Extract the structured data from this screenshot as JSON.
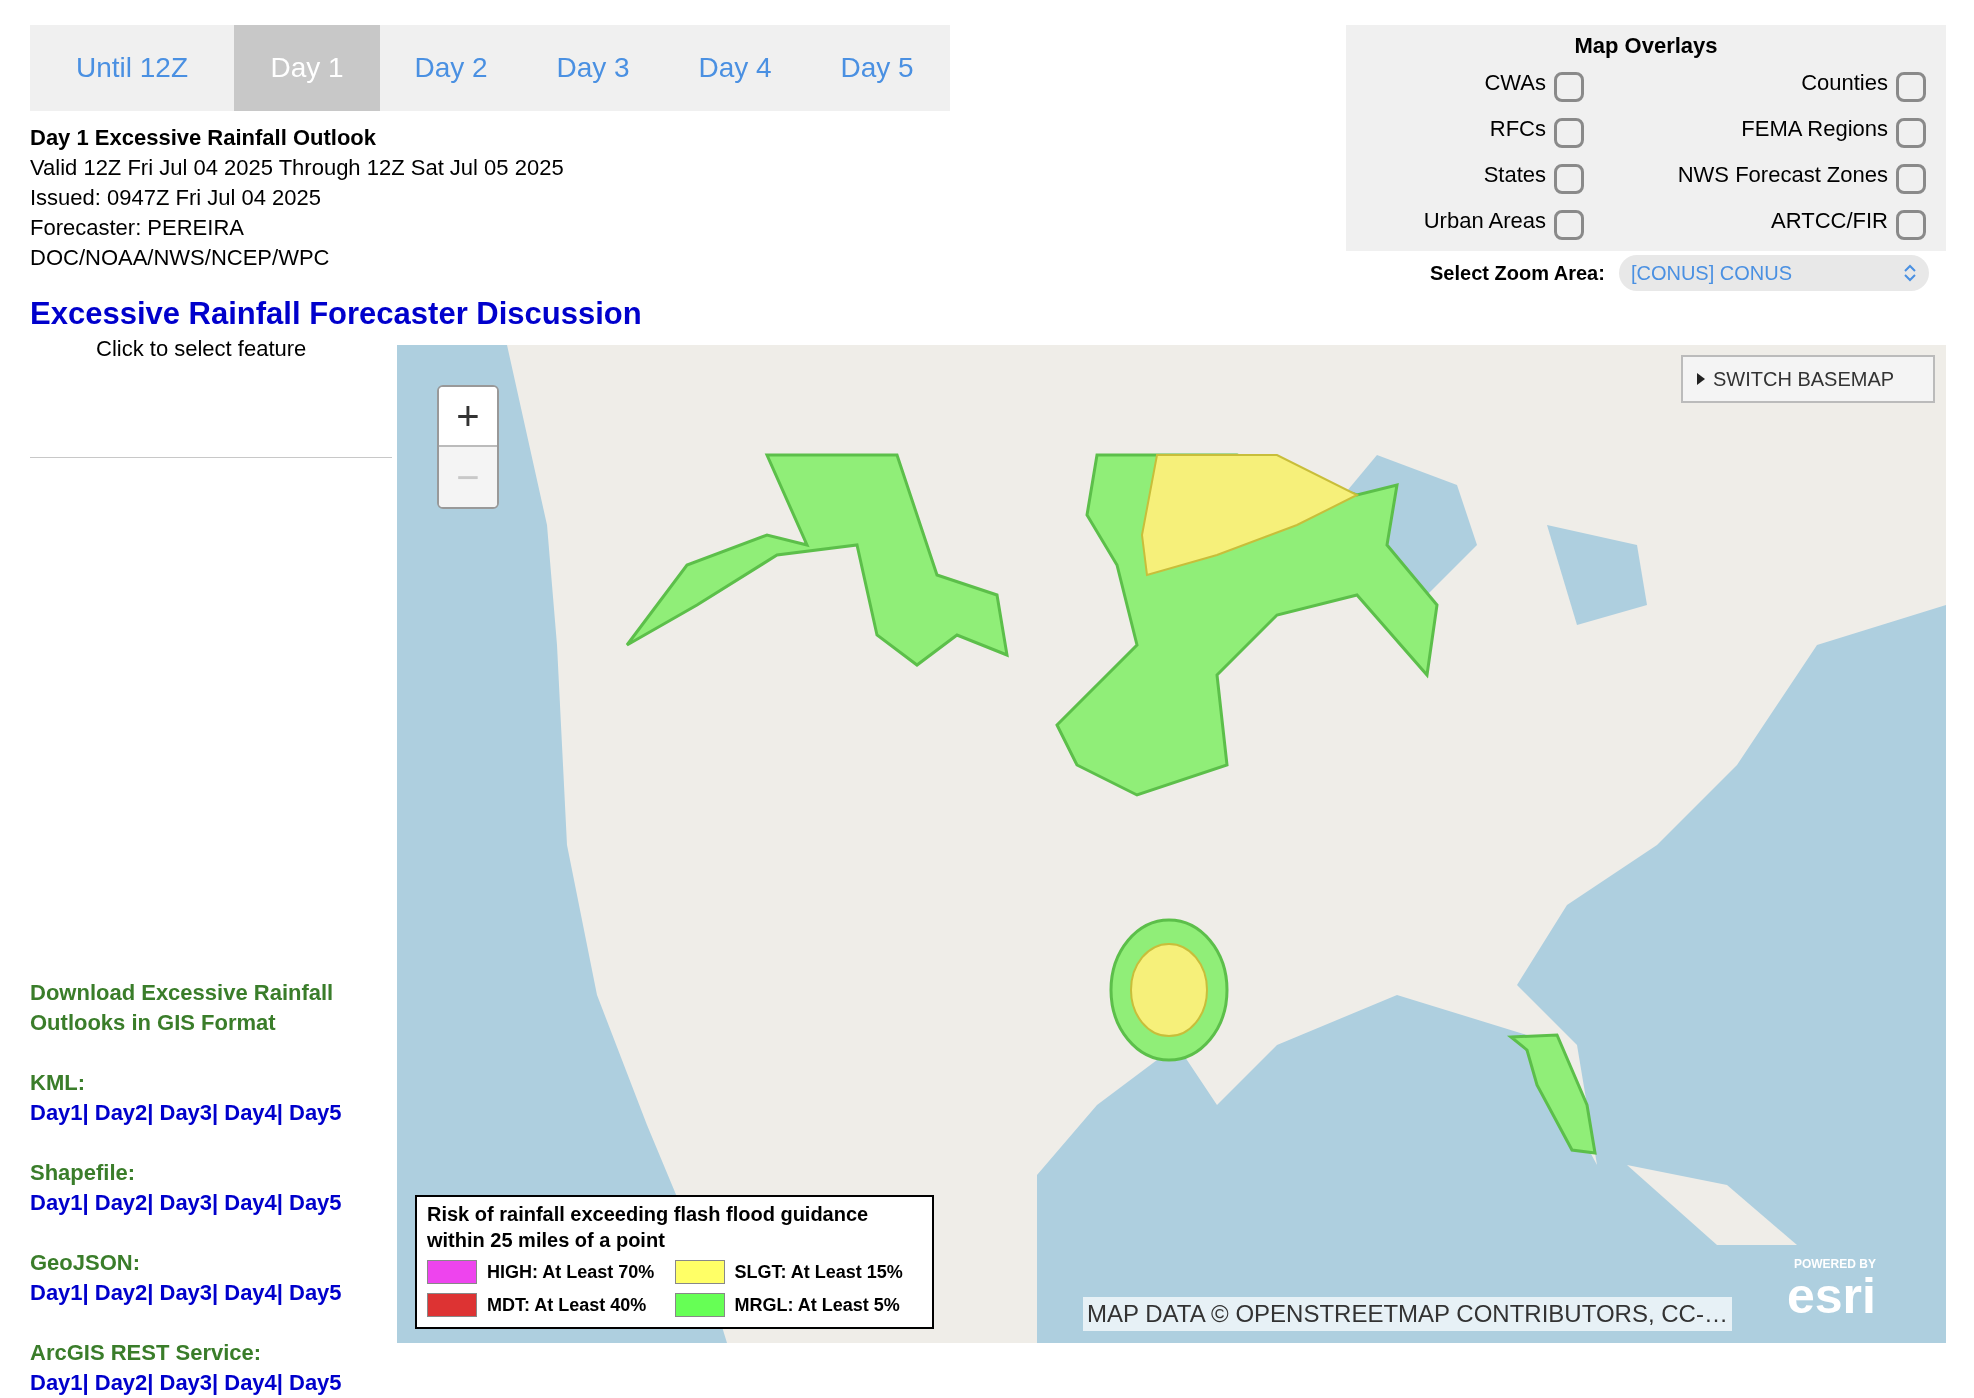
{
  "tabs": [
    {
      "label": "Until 12Z",
      "selected": false
    },
    {
      "label": "Day 1",
      "selected": true
    },
    {
      "label": "Day 2",
      "selected": false
    },
    {
      "label": "Day 3",
      "selected": false
    },
    {
      "label": "Day 4",
      "selected": false
    },
    {
      "label": "Day 5",
      "selected": false
    }
  ],
  "outlook": {
    "title": "Day 1 Excessive Rainfall Outlook",
    "lines": [
      "Valid 12Z Fri Jul 04 2025 Through 12Z Sat Jul 05 2025",
      "Issued: 0947Z Fri Jul 04 2025",
      "Forecaster: PEREIRA",
      "DOC/NOAA/NWS/NCEP/WPC"
    ]
  },
  "discussion_link": "Excessive Rainfall Forecaster Discussion",
  "map_overlays": {
    "title": "Map Overlays",
    "items": [
      {
        "label": "CWAs",
        "checked": false
      },
      {
        "label": "Counties",
        "checked": false
      },
      {
        "label": "RFCs",
        "checked": false
      },
      {
        "label": "FEMA Regions",
        "checked": false
      },
      {
        "label": "States",
        "checked": false
      },
      {
        "label": "NWS Forecast Zones",
        "checked": false
      },
      {
        "label": "Urban Areas",
        "checked": false
      },
      {
        "label": "ARTCC/FIR",
        "checked": false
      }
    ]
  },
  "zoom_area": {
    "label": "Select Zoom Area:",
    "value": "[CONUS] CONUS"
  },
  "feature_hint": "Click to select feature",
  "downloads": {
    "title": "Download Excessive Rainfall Outlooks in GIS Format",
    "separator": "|",
    "sections": [
      {
        "label": "KML:",
        "links": [
          "Day1",
          "Day2",
          "Day3",
          "Day4",
          "Day5"
        ]
      },
      {
        "label": "Shapefile:",
        "links": [
          "Day1",
          "Day2",
          "Day3",
          "Day4",
          "Day5"
        ]
      },
      {
        "label": "GeoJSON:",
        "links": [
          "Day1",
          "Day2",
          "Day3",
          "Day4",
          "Day5"
        ]
      },
      {
        "label": "ArcGIS REST Service:",
        "links": [
          "Day1",
          "Day2",
          "Day3",
          "Day4",
          "Day5"
        ]
      }
    ]
  },
  "map": {
    "kind": "picture",
    "zoom_buttons": [
      {
        "label": "+",
        "disabled": false
      },
      {
        "label": "−",
        "disabled": true
      }
    ],
    "switch_basemap": "SWITCH BASEMAP",
    "legend": {
      "title": "Risk of rainfall exceeding flash flood guidance within 25 miles of a point",
      "items": [
        {
          "label": "HIGH: At Least 70%",
          "color": "#ee44ee"
        },
        {
          "label": "SLGT: At Least 15%",
          "color": "#ffff66"
        },
        {
          "label": "MDT: At Least 40%",
          "color": "#dd3333"
        },
        {
          "label": "MRGL: At Least 5%",
          "color": "#66ff55"
        }
      ]
    },
    "attribution": "MAP DATA © OPENSTREETMAP CONTRIBUTORS, CC-…",
    "logo": {
      "tagline": "POWERED BY",
      "name": "esri"
    }
  }
}
